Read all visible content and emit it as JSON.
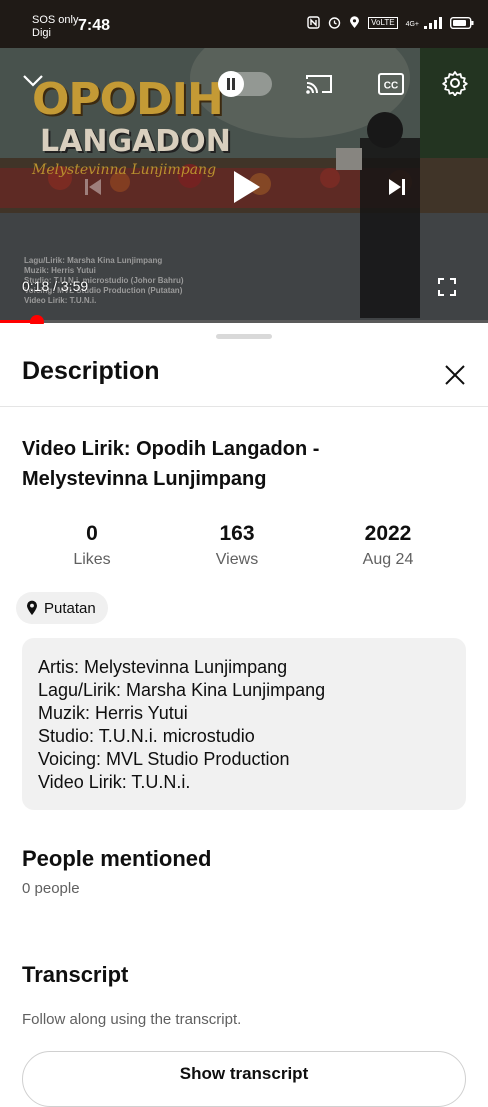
{
  "status_bar": {
    "carrier_line1": "SOS only",
    "carrier_line2": "Digi",
    "time": "7:48",
    "volte_label": "VoLTE",
    "network_label": "4G+",
    "icons": [
      "nfc-icon",
      "alarm-icon",
      "location-icon",
      "volte-icon",
      "signal-icon",
      "battery-icon"
    ]
  },
  "player": {
    "overlay_title": "OPODIH",
    "overlay_subtitle": "LANGADON",
    "overlay_artist": "Melystevinna Lunjimpang",
    "credits": [
      "Lagu/Lirik: Marsha Kina Lunjimpang",
      "Muzik: Herris Yutui",
      "Studio: T.U.N.i. microstudio (Johor Bahru)",
      "Voicing: MVL Studio Production (Putatan)",
      "Video Lirik: T.U.N.i."
    ],
    "current_time": "0:18",
    "separator": "/",
    "duration": "3:59",
    "progress_fraction": 0.075,
    "autoplay_on": false,
    "icons": [
      "chevron-down-icon",
      "pause-icon",
      "cast-icon",
      "captions-icon",
      "settings-gear-icon",
      "previous-icon",
      "play-icon",
      "next-icon",
      "fullscreen-icon"
    ],
    "accent_color": "#ff0000"
  },
  "sheet": {
    "title": "Description",
    "close_icon": "close-icon",
    "video_title": "Video Lirik: Opodih Langadon - Melystevinna Lunjimpang",
    "stats": [
      {
        "value": "0",
        "label": "Likes"
      },
      {
        "value": "163",
        "label": "Views"
      },
      {
        "value": "2022",
        "label": "Aug 24"
      }
    ],
    "location": "Putatan",
    "description_lines": [
      "Artis: Melystevinna Lunjimpang",
      "Lagu/Lirik: Marsha Kina Lunjimpang",
      "Muzik: Herris Yutui",
      "Studio: T.U.N.i. microstudio",
      "Voicing: MVL Studio Production",
      "Video Lirik: T.U.N.i."
    ],
    "people_title": "People mentioned",
    "people_count": "0 people",
    "transcript_title": "Transcript",
    "transcript_sub": "Follow along using the transcript.",
    "transcript_button": "Show transcript"
  }
}
